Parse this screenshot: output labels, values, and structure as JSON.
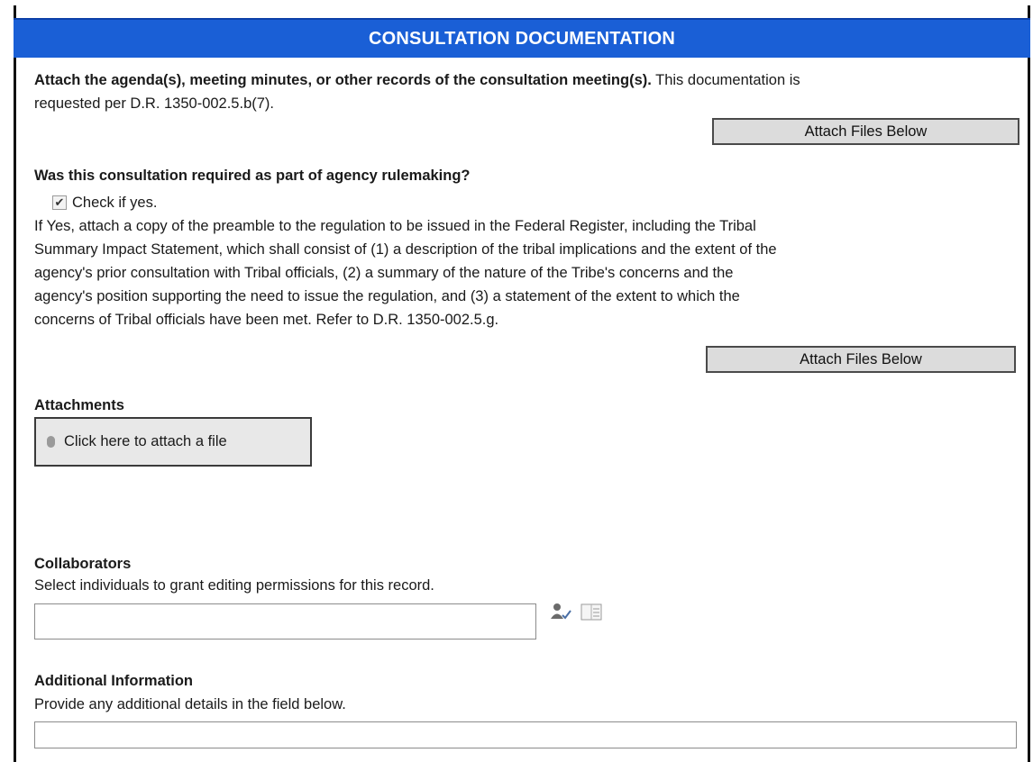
{
  "header": {
    "title": "CONSULTATION DOCUMENTATION"
  },
  "section1": {
    "bold_text": "Attach the agenda(s), meeting minutes, or other records of the consultation meeting(s).",
    "normal_text": "This documentation is",
    "line2": "requested per D.R. 1350-002.5.b(7).",
    "button_label": "Attach Files Below"
  },
  "section2": {
    "question": "Was this consultation required as part of agency rulemaking?",
    "checkbox_label": "Check if yes.",
    "checkbox_checked": true,
    "paragraph_lines": [
      "If Yes, attach a copy of the preamble to the regulation to be issued in the Federal Register, including the Tribal",
      "Summary Impact Statement, which shall consist of (1) a description of the tribal implications and the extent of the",
      "agency's prior consultation with Tribal officials, (2) a summary of the nature of the Tribe's concerns and the",
      "agency's position supporting the need to issue the regulation, and (3) a statement of the extent to which the",
      "concerns of Tribal officials have been met.  Refer to D.R. 1350-002.5.g."
    ],
    "button_label": "Attach Files Below"
  },
  "attachments": {
    "label": "Attachments",
    "button_label": "Click here to attach a file"
  },
  "collaborators": {
    "label": "Collaborators",
    "help": "Select individuals to grant editing permissions for this record.",
    "value": ""
  },
  "additional": {
    "label": "Additional Information",
    "help": "Provide any additional details in the field below.",
    "value": ""
  }
}
